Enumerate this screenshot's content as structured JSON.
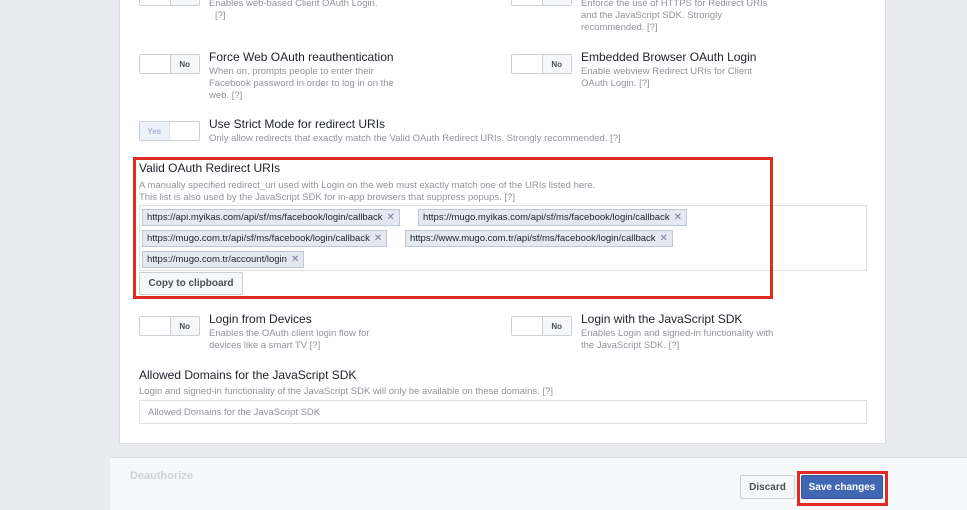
{
  "top": {
    "left_desc_line": "Enables web-based Client OAuth Login.",
    "left_help": "[?]",
    "right_desc": "Enforce the use of HTTPS for Redirect URIs and the JavaScript SDK. Strongly recommended.",
    "right_help": "[?]"
  },
  "force_web": {
    "title": "Force Web OAuth reauthentication",
    "desc": "When on, prompts people to enter their Facebook password in order to log in on the web.",
    "help": "[?]",
    "toggle": "No"
  },
  "embedded": {
    "title": "Embedded Browser OAuth Login",
    "desc": "Enable webview Redirect URIs for Client OAuth Login.",
    "help": "[?]",
    "toggle": "No"
  },
  "strict": {
    "title": "Use Strict Mode for redirect URIs",
    "desc": "Only allow redirects that exactly match the Valid OAuth Redirect URIs. Strongly recommended.",
    "help": "[?]",
    "toggle": "Yes"
  },
  "redirect": {
    "title": "Valid OAuth Redirect URIs",
    "desc": "A manually specified redirect_uri used with Login on the web must exactly match one of the URIs listed here. This list is also used by the JavaScript SDK for in-app browsers that suppress popups.",
    "help": "[?]",
    "uris": [
      "https://api.myikas.com/api/sf/ms/facebook/login/callback",
      "https://mugo.myikas.com/api/sf/ms/facebook/login/callback",
      "https://mugo.com.tr/api/sf/ms/facebook/login/callback",
      "https://www.mugo.com.tr/api/sf/ms/facebook/login/callback",
      "https://mugo.com.tr/account/login"
    ],
    "copy_label": "Copy to clipboard"
  },
  "devices": {
    "title": "Login from Devices",
    "desc": "Enables the OAuth client login flow for devices like a smart TV",
    "help": "[?]",
    "toggle": "No"
  },
  "jssdk": {
    "title": "Login with the JavaScript SDK",
    "desc": "Enables Login and signed-in functionality with the JavaScript SDK.",
    "help": "[?]",
    "toggle": "No"
  },
  "domains": {
    "title": "Allowed Domains for the JavaScript SDK",
    "desc": "Login and signed-in functionality of the JavaScript SDK will only be available on these domains.",
    "help": "[?]",
    "placeholder": "Allowed Domains for the JavaScript SDK"
  },
  "footer": {
    "deauthorize": "Deauthorize",
    "discard": "Discard",
    "save": "Save changes"
  },
  "colors": {
    "accent": "#4267b2",
    "highlight": "#e02a24"
  }
}
